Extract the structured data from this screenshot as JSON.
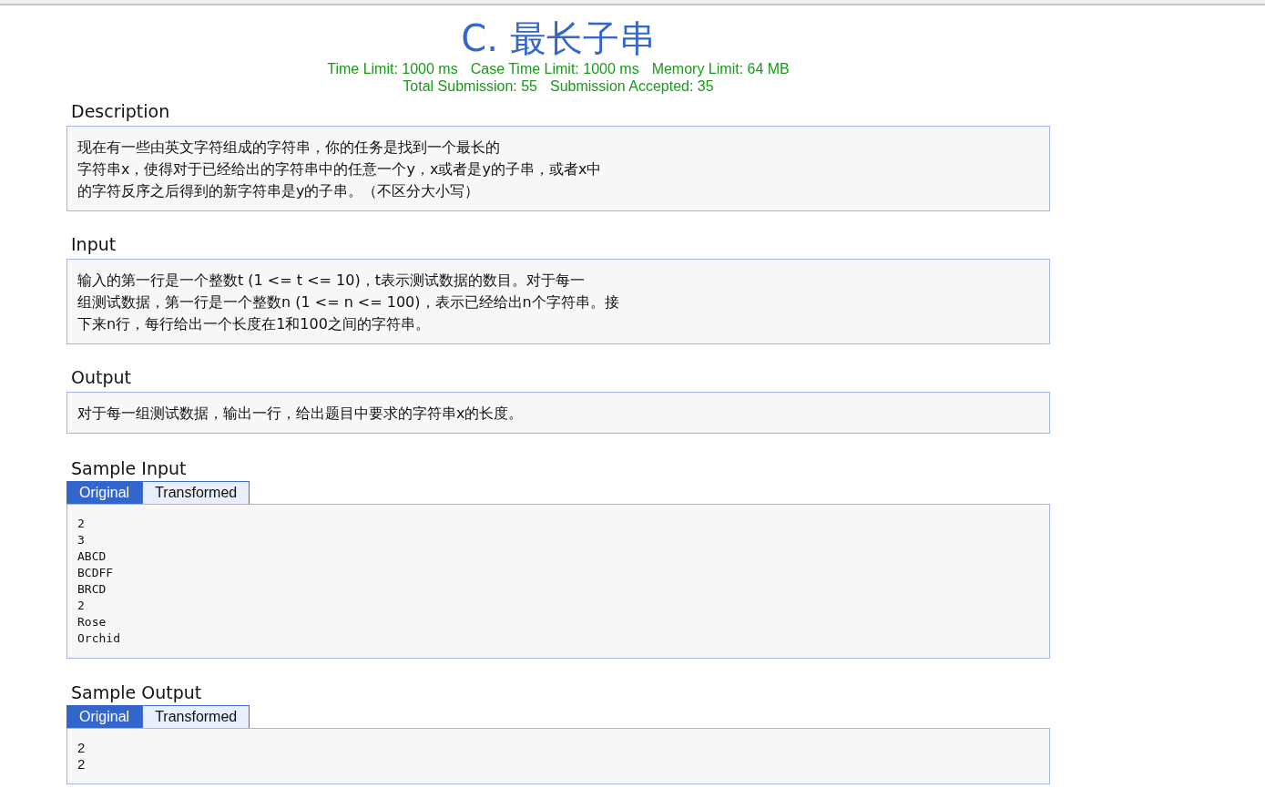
{
  "problem": {
    "title": "C. 最长子串",
    "limits": [
      "Time Limit: 1000 ms",
      "Case Time Limit: 1000 ms",
      "Memory Limit: 64 MB"
    ],
    "stats": [
      "Total Submission: 55",
      "Submission Accepted: 35"
    ]
  },
  "sections": [
    {
      "heading": "Description",
      "lines": [
        "现在有一些由英文字符组成的字符串，你的任务是找到一个最长的",
        "字符串x，使得对于已经给出的字符串中的任意一个y，x或者是y的子串，或者x中",
        "的字符反序之后得到的新字符串是y的子串。（不区分大小写）"
      ]
    },
    {
      "heading": "Input",
      "lines": [
        "输入的第一行是一个整数t (1 <= t <= 10)，t表示测试数据的数目。对于每一",
        "组测试数据，第一行是一个整数n (1 <= n <= 100)，表示已经给出n个字符串。接",
        "下来n行，每行给出一个长度在1和100之间的字符串。"
      ]
    },
    {
      "heading": "Output",
      "lines": [
        "对于每一组测试数据，输出一行，给出题目中要求的字符串x的长度。"
      ]
    }
  ],
  "samples": [
    {
      "heading": "Sample Input",
      "kind": "code",
      "tabs": [
        {
          "label": "Original",
          "selected": true
        },
        {
          "label": "Transformed",
          "selected": false
        }
      ],
      "lines": [
        "2",
        "3",
        "ABCD",
        "BCDFF",
        "BRCD",
        "2",
        "Rose",
        "Orchid"
      ]
    },
    {
      "heading": "Sample Output",
      "kind": "text",
      "tabs": [
        {
          "label": "Original",
          "selected": true
        },
        {
          "label": "Transformed",
          "selected": false
        }
      ],
      "lines": [
        "2",
        "2"
      ]
    }
  ]
}
